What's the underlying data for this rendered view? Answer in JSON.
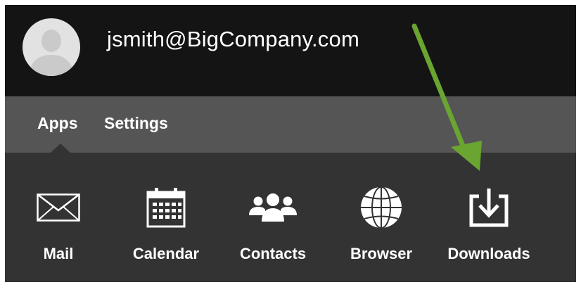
{
  "user": {
    "email": "jsmith@BigCompany.com",
    "avatar_icon": "user-silhouette-icon"
  },
  "tabs": [
    {
      "label": "Apps",
      "selected": true
    },
    {
      "label": "Settings",
      "selected": false
    }
  ],
  "apps": [
    {
      "label": "Mail",
      "icon": "envelope-icon"
    },
    {
      "label": "Calendar",
      "icon": "calendar-icon"
    },
    {
      "label": "Contacts",
      "icon": "people-icon"
    },
    {
      "label": "Browser",
      "icon": "globe-icon"
    },
    {
      "label": "Downloads",
      "icon": "download-icon"
    }
  ],
  "annotation": {
    "icon": "callout-arrow-icon",
    "color": "#6aa431"
  },
  "colors": {
    "header_bg": "#141414",
    "tabbar_bg": "#555555",
    "content_bg": "#333333",
    "text": "#ffffff"
  }
}
